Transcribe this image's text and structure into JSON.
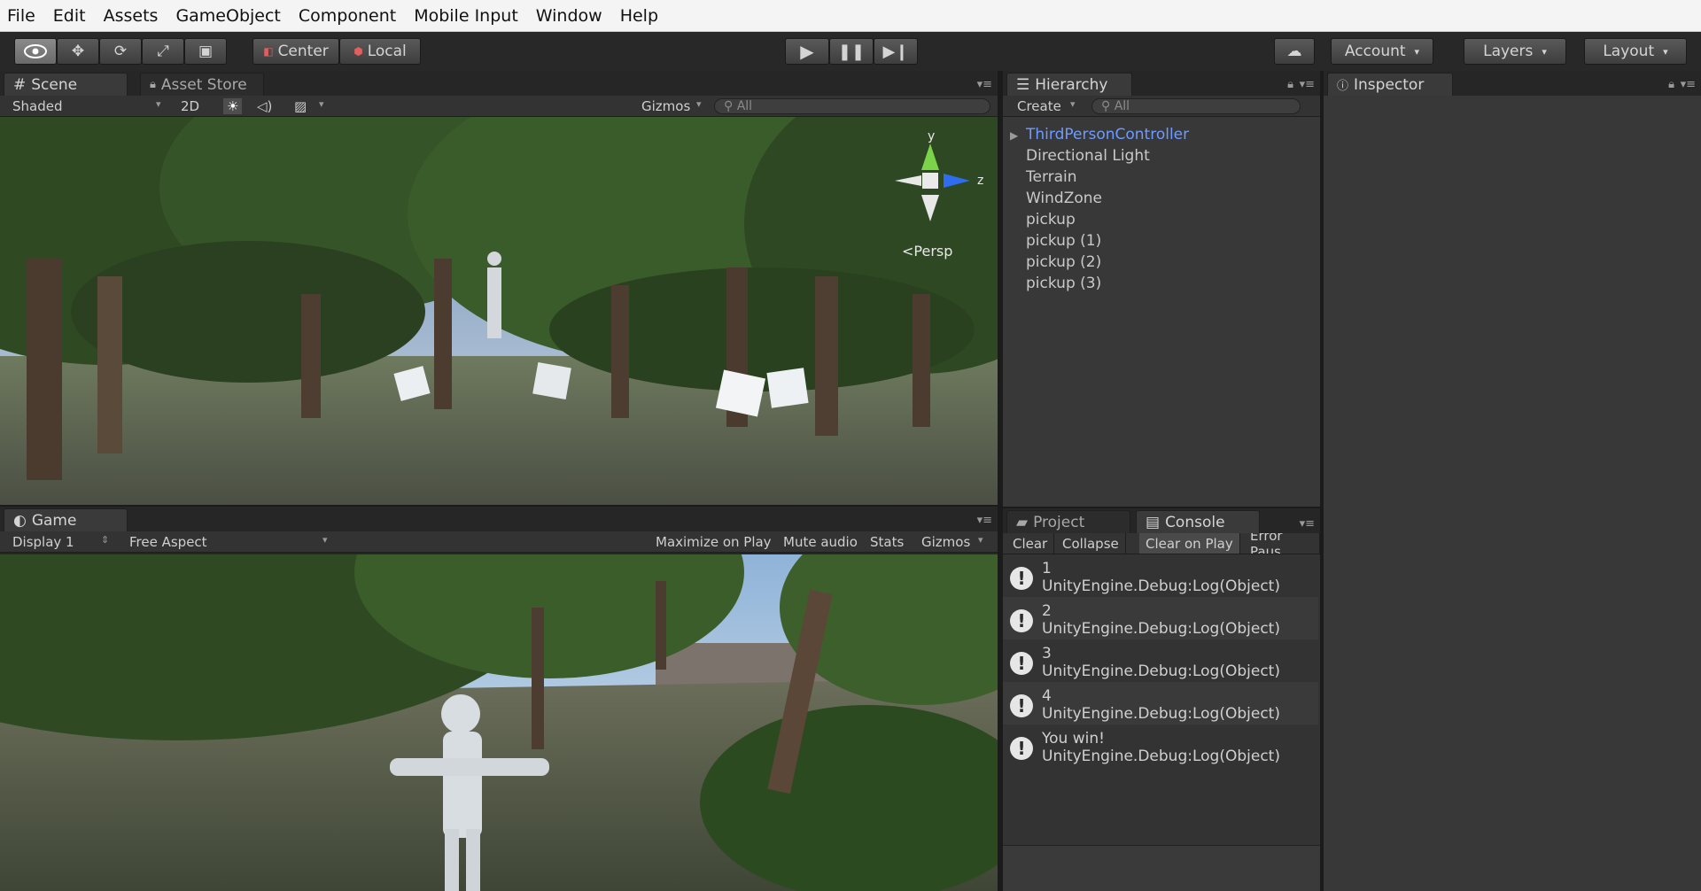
{
  "menu": [
    "File",
    "Edit",
    "Assets",
    "GameObject",
    "Component",
    "Mobile Input",
    "Window",
    "Help"
  ],
  "toolbar": {
    "pivot": "Center",
    "space": "Local",
    "account": "Account",
    "layers": "Layers",
    "layout": "Layout"
  },
  "scene": {
    "tab": "Scene",
    "tab2": "Asset Store",
    "shading": "Shaded",
    "mode2d": "2D",
    "gizmos": "Gizmos",
    "search_placeholder": "All",
    "persp": "Persp",
    "axis_y": "y",
    "axis_z": "z"
  },
  "game": {
    "tab": "Game",
    "display": "Display 1",
    "aspect": "Free Aspect",
    "maximize": "Maximize on Play",
    "mute": "Mute audio",
    "stats": "Stats",
    "gizmos": "Gizmos"
  },
  "hierarchy": {
    "tab": "Hierarchy",
    "create": "Create",
    "search_placeholder": "All",
    "items": [
      "ThirdPersonController",
      "Directional Light",
      "Terrain",
      "WindZone",
      "pickup",
      "pickup (1)",
      "pickup (2)",
      "pickup (3)"
    ]
  },
  "console": {
    "tab_project": "Project",
    "tab_console": "Console",
    "buttons": [
      "Clear",
      "Collapse",
      "Clear on Play",
      "Error Paus"
    ],
    "logs": [
      {
        "msg": "1",
        "src": "UnityEngine.Debug:Log(Object)"
      },
      {
        "msg": "2",
        "src": "UnityEngine.Debug:Log(Object)"
      },
      {
        "msg": "3",
        "src": "UnityEngine.Debug:Log(Object)"
      },
      {
        "msg": "4",
        "src": "UnityEngine.Debug:Log(Object)"
      },
      {
        "msg": "You win!",
        "src": "UnityEngine.Debug:Log(Object)"
      }
    ]
  },
  "inspector": {
    "tab": "Inspector"
  }
}
